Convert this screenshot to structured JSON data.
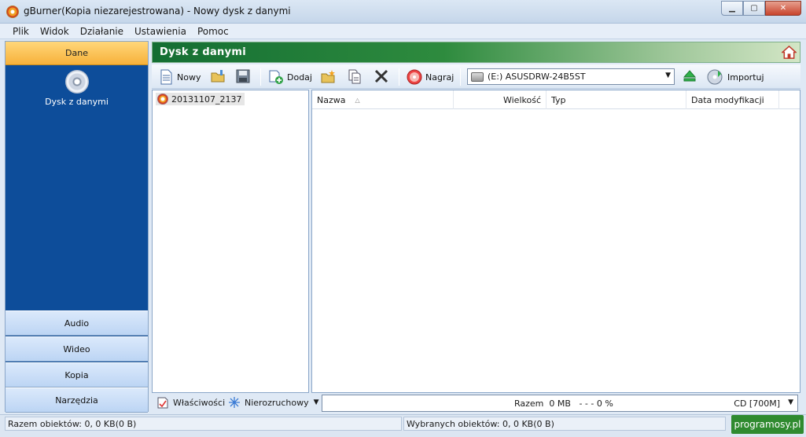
{
  "window": {
    "title": "gBurner(Kopia niezarejestrowana) - Nowy dysk z danymi",
    "minimize": "▁",
    "maximize": "▢",
    "close": "✕"
  },
  "menu": [
    "Plik",
    "Widok",
    "Działanie",
    "Ustawienia",
    "Pomoc"
  ],
  "sidebar": {
    "active": "Dane",
    "active_item": "Dysk z danymi",
    "items": [
      "Audio",
      "Wideo",
      "Kopia",
      "Narzędzia"
    ]
  },
  "header": {
    "title": "Dysk z danymi"
  },
  "toolbar": {
    "new": "Nowy",
    "add": "Dodaj",
    "burn": "Nagraj",
    "drive": "(E:) ASUSDRW-24B5ST",
    "import": "Importuj"
  },
  "tree": {
    "root": "20131107_2137"
  },
  "list": {
    "columns": [
      "Nazwa",
      "Wielkość",
      "Typ",
      "Data modyfikacji"
    ],
    "sort_indicator": "△"
  },
  "bottom": {
    "properties": "Właściwości",
    "boot": "Nierozruchowy",
    "total_label": "Razem",
    "total_size": "0 MB",
    "progress": "- - -  0 %",
    "media": "CD [700M]"
  },
  "status": {
    "total": "Razem obiektów: 0, 0 KB(0 B)",
    "selected": "Wybranych obiektów: 0, 0 KB(0 B)",
    "watermark": "programosy.pl"
  },
  "colors": {
    "sidebar": "#0d4d9a",
    "header_green": "#146e33",
    "active_tab": "#f7b13a"
  }
}
